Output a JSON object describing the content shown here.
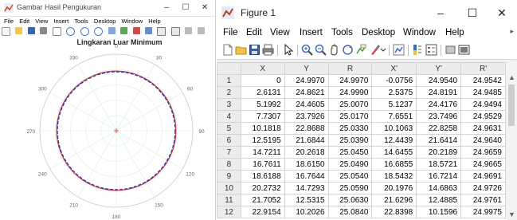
{
  "left_window": {
    "title": "Gambar Hasil Pengukuran",
    "menu": [
      "File",
      "Edit",
      "View",
      "Insert",
      "Tools",
      "Desktop",
      "Window",
      "Help"
    ],
    "plot": {
      "title": "Lingkaran Luar Minimum",
      "angle_labels": [
        "0",
        "30",
        "60",
        "90",
        "120",
        "150",
        "180",
        "210",
        "240",
        "270",
        "300",
        "330"
      ],
      "colors": {
        "circle_outer": "#cc3a3a",
        "circle_inner": "#1f3b99",
        "measured": "#8a3ac0",
        "center": "#e05050",
        "grid": "#d8efe2"
      }
    }
  },
  "right_window": {
    "title": "Figure 1",
    "menu": [
      "File",
      "Edit",
      "View",
      "Insert",
      "Tools",
      "Desktop",
      "Window",
      "Help"
    ],
    "table": {
      "columns": [
        "X",
        "Y",
        "R",
        "X'",
        "Y'",
        "R'"
      ],
      "rows": [
        [
          "1",
          "0",
          "24.9970",
          "24.9970",
          "-0.0756",
          "24.9540",
          "24.9542"
        ],
        [
          "2",
          "2.6131",
          "24.8621",
          "24.9990",
          "2.5375",
          "24.8191",
          "24.9485"
        ],
        [
          "3",
          "5.1992",
          "24.4605",
          "25.0070",
          "5.1237",
          "24.4176",
          "24.9494"
        ],
        [
          "4",
          "7.7307",
          "23.7926",
          "25.0170",
          "7.6551",
          "23.7496",
          "24.9529"
        ],
        [
          "5",
          "10.1818",
          "22.8688",
          "25.0330",
          "10.1063",
          "22.8258",
          "24.9631"
        ],
        [
          "6",
          "12.5195",
          "21.6844",
          "25.0390",
          "12.4439",
          "21.6414",
          "24.9640"
        ],
        [
          "7",
          "14.7211",
          "20.2618",
          "25.0450",
          "14.6455",
          "20.2189",
          "24.9659"
        ],
        [
          "8",
          "16.7611",
          "18.6150",
          "25.0490",
          "16.6855",
          "18.5721",
          "24.9665"
        ],
        [
          "9",
          "18.6188",
          "16.7644",
          "25.0540",
          "18.5432",
          "16.7214",
          "24.9691"
        ],
        [
          "10",
          "20.2732",
          "14.7293",
          "25.0590",
          "20.1976",
          "14.6863",
          "24.9726"
        ],
        [
          "11",
          "21.7052",
          "12.5315",
          "25.0630",
          "21.6296",
          "12.4885",
          "24.9761"
        ],
        [
          "12",
          "22.9154",
          "10.2026",
          "25.0840",
          "22.8398",
          "10.1596",
          "24.9975"
        ]
      ]
    }
  }
}
